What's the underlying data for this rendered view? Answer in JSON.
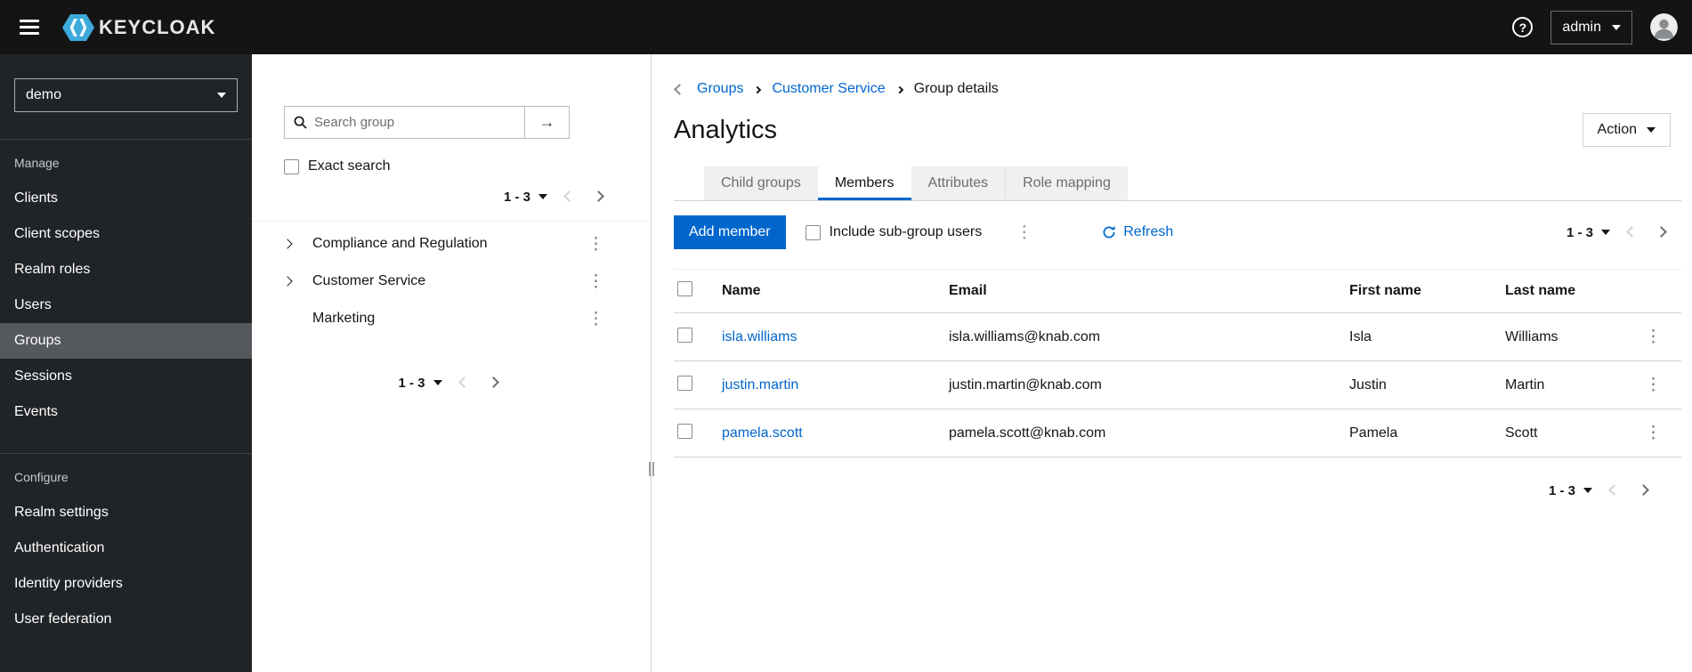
{
  "colors": {
    "accent": "#0066cc",
    "masthead-bg": "#141414",
    "sidebar-bg": "#212427",
    "sidebar-selected": "#55585c",
    "brand-cyan": "#3caadb",
    "border": "#d2d2d2",
    "muted-text": "#6a6e73"
  },
  "icons": {
    "hamburger": "menu-bars",
    "help": "?",
    "search": "magnifier",
    "arrow_right": "→",
    "kebab": "⋮",
    "caret_down": "▾",
    "chevron_left": "‹",
    "chevron_right": "›",
    "refresh": "sync-arrows",
    "avatar": "user-circle"
  },
  "masthead": {
    "brand": "KEYCLOAK",
    "user": "admin"
  },
  "sidebar": {
    "realm": "demo",
    "selected_item": "Groups",
    "sections": [
      {
        "label": "Manage",
        "items": [
          "Clients",
          "Client scopes",
          "Realm roles",
          "Users",
          "Groups",
          "Sessions",
          "Events"
        ]
      },
      {
        "label": "Configure",
        "items": [
          "Realm settings",
          "Authentication",
          "Identity providers",
          "User federation"
        ]
      }
    ]
  },
  "groups_panel": {
    "search_placeholder": "Search group",
    "exact_search_label": "Exact search",
    "pagination_top": "1 - 3",
    "pagination_bottom": "1 - 3",
    "tree": [
      {
        "label": "Compliance and Regulation",
        "expandable": true
      },
      {
        "label": "Customer Service",
        "expandable": true
      },
      {
        "label": "Marketing",
        "expandable": false
      }
    ]
  },
  "main": {
    "breadcrumb": [
      "Groups",
      "Customer Service",
      "Group details"
    ],
    "title": "Analytics",
    "action_label": "Action",
    "tabs": [
      {
        "label": "Child groups",
        "active": false
      },
      {
        "label": "Members",
        "active": true
      },
      {
        "label": "Attributes",
        "active": false
      },
      {
        "label": "Role mapping",
        "active": false
      }
    ],
    "toolbar": {
      "add_member_label": "Add member",
      "include_subgroup_label": "Include sub-group users",
      "refresh_label": "Refresh",
      "pagination": "1 - 3"
    },
    "table": {
      "headers": [
        "Name",
        "Email",
        "First name",
        "Last name"
      ],
      "rows": [
        {
          "name": "isla.williams",
          "email": "isla.williams@knab.com",
          "first_name": "Isla",
          "last_name": "Williams"
        },
        {
          "name": "justin.martin",
          "email": "justin.martin@knab.com",
          "first_name": "Justin",
          "last_name": "Martin"
        },
        {
          "name": "pamela.scott",
          "email": "pamela.scott@knab.com",
          "first_name": "Pamela",
          "last_name": "Scott"
        }
      ],
      "pagination": "1 - 3"
    }
  }
}
